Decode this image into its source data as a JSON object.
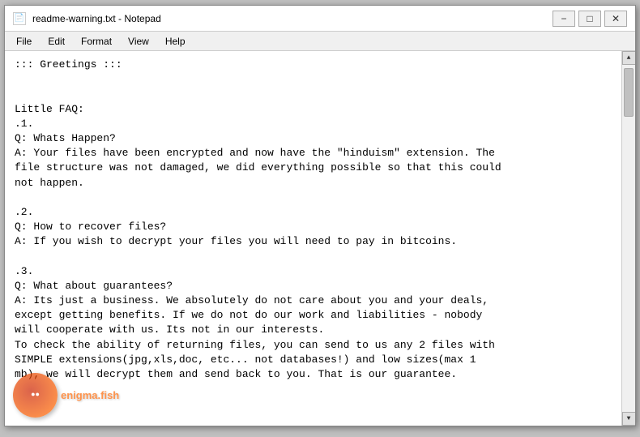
{
  "window": {
    "title": "readme-warning.txt - Notepad",
    "icon": "📄"
  },
  "titlebar": {
    "minimize_label": "−",
    "maximize_label": "□",
    "close_label": "✕"
  },
  "menu": {
    "items": [
      "File",
      "Edit",
      "Format",
      "View",
      "Help"
    ]
  },
  "content": {
    "text": "::: Greetings :::\n\n\nLittle FAQ:\n.1.\nQ: Whats Happen?\nA: Your files have been encrypted and now have the \"hinduism\" extension. The\nfile structure was not damaged, we did everything possible so that this could\nnot happen.\n\n.2.\nQ: How to recover files?\nA: If you wish to decrypt your files you will need to pay in bitcoins.\n\n.3.\nQ: What about guarantees?\nA: Its just a business. We absolutely do not care about you and your deals,\nexcept getting benefits. If we do not do our work and liabilities - nobody\nwill cooperate with us. Its not in our interests.\nTo check the ability of returning files, you can send to us any 2 files with\nSIMPLE extensions(jpg,xls,doc, etc... not databases!) and low sizes(max 1\nmb), we will decrypt them and send back to you. That is our guarantee."
  },
  "watermark": {
    "site": "enigma.fish",
    "display": "enigma.fish"
  }
}
